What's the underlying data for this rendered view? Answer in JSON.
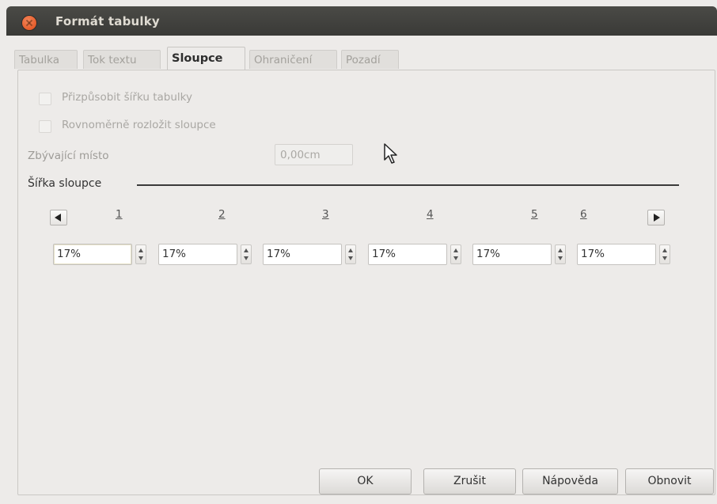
{
  "window": {
    "title": "Formát tabulky"
  },
  "tabs": [
    {
      "label": "Tabulka",
      "active": false
    },
    {
      "label": "Tok textu",
      "active": false
    },
    {
      "label": "Sloupce",
      "active": true
    },
    {
      "label": "Ohraničení",
      "active": false
    },
    {
      "label": "Pozadí",
      "active": false
    }
  ],
  "options": {
    "fit_width": {
      "label": "Přizpůsobit šířku tabulky",
      "checked": false,
      "enabled": false
    },
    "distribute": {
      "label": "Rovnoměrně rozložit sloupce",
      "checked": false,
      "enabled": false
    }
  },
  "remaining": {
    "label": "Zbývající místo",
    "value": "0,00cm"
  },
  "column_width": {
    "title": "Šířka sloupce",
    "columns": [
      {
        "number": "1",
        "value": "17%"
      },
      {
        "number": "2",
        "value": "17%"
      },
      {
        "number": "3",
        "value": "17%"
      },
      {
        "number": "4",
        "value": "17%"
      },
      {
        "number": "5",
        "value": "17%"
      },
      {
        "number": "6",
        "value": "17%"
      }
    ]
  },
  "buttons": {
    "ok": "OK",
    "cancel": "Zrušit",
    "help": "Nápověda",
    "reset": "Obnovit"
  },
  "colors": {
    "titlebar": "#3f3f3c",
    "close": "#e8622e",
    "background": "#edebe9"
  }
}
